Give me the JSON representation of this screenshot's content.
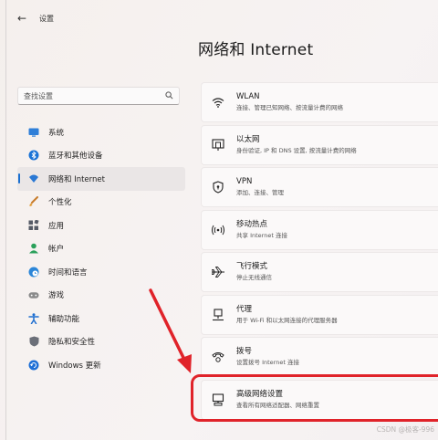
{
  "window": {
    "back_glyph": "←",
    "app_title": "设置"
  },
  "page_title": "网络和 Internet",
  "search": {
    "placeholder": "查找设置",
    "icon": "search-icon"
  },
  "sidebar": {
    "items": [
      {
        "label": "系统",
        "icon": "system-icon",
        "color": "#2f7fd8"
      },
      {
        "label": "蓝牙和其他设备",
        "icon": "bluetooth-icon",
        "color": "#1a73d6"
      },
      {
        "label": "网络和 Internet",
        "icon": "wifi-icon",
        "color": "#2a78d4",
        "active": true
      },
      {
        "label": "个性化",
        "icon": "brush-icon",
        "color": "#d9822b"
      },
      {
        "label": "应用",
        "icon": "apps-icon",
        "color": "#555a66"
      },
      {
        "label": "帐户",
        "icon": "account-icon",
        "color": "#2aa05a"
      },
      {
        "label": "时间和语言",
        "icon": "globe-clock-icon",
        "color": "#2c86d8"
      },
      {
        "label": "游戏",
        "icon": "gamepad-icon",
        "color": "#7a7a7a"
      },
      {
        "label": "辅助功能",
        "icon": "accessibility-icon",
        "color": "#1e6fd0"
      },
      {
        "label": "隐私和安全性",
        "icon": "shield-icon",
        "color": "#6b6f78"
      },
      {
        "label": "Windows 更新",
        "icon": "update-icon",
        "color": "#1d6fd6"
      }
    ]
  },
  "cards": [
    {
      "title": "WLAN",
      "subtitle": "连接、管理已知网络、按流量计费的网络",
      "icon": "wifi-icon"
    },
    {
      "title": "以太网",
      "subtitle": "身份验证, IP 和 DNS 设置, 按流量计费的网络",
      "icon": "ethernet-icon"
    },
    {
      "title": "VPN",
      "subtitle": "添加、连接、管理",
      "icon": "vpn-shield-icon"
    },
    {
      "title": "移动热点",
      "subtitle": "共享 Internet 连接",
      "icon": "hotspot-icon"
    },
    {
      "title": "飞行模式",
      "subtitle": "停止无线通信",
      "icon": "airplane-icon"
    },
    {
      "title": "代理",
      "subtitle": "用于 Wi-Fi 和以太网连接的代理服务器",
      "icon": "proxy-icon"
    },
    {
      "title": "拨号",
      "subtitle": "设置拨号 Internet 连接",
      "icon": "dialup-icon"
    },
    {
      "title": "高级网络设置",
      "subtitle": "查看所有网络适配器、网络重置",
      "icon": "advanced-network-icon"
    }
  ],
  "annotation_color": "#e0232a",
  "watermark": "CSDN @极客-996"
}
